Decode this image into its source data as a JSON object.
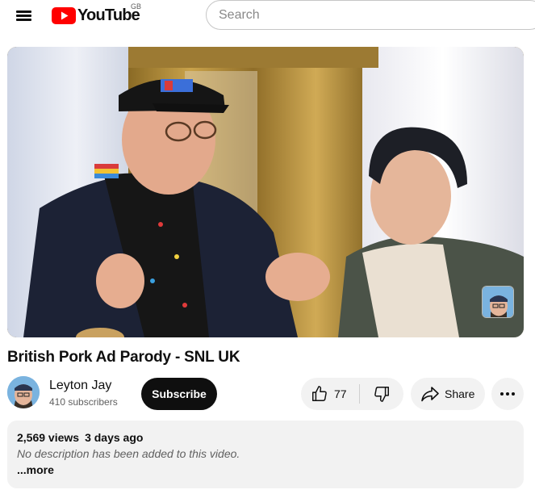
{
  "header": {
    "logo_text": "YouTube",
    "region": "GB",
    "search_placeholder": "Search"
  },
  "video": {
    "title": "British Pork Ad Parody - SNL UK"
  },
  "channel": {
    "name": "Leyton Jay",
    "subscribers": "410 subscribers",
    "subscribe_label": "Subscribe"
  },
  "actions": {
    "like_count": "77",
    "share_label": "Share"
  },
  "description": {
    "views": "2,569 views",
    "date": "3 days ago",
    "text": "No description has been added to this video.",
    "more_label": "...more"
  },
  "colors": {
    "brand_red": "#ff0000",
    "button_bg": "#f2f2f2",
    "subscribe_bg": "#0f0f0f"
  },
  "icons": [
    "menu-icon",
    "youtube-logo-icon",
    "thumbs-up-icon",
    "thumbs-down-icon",
    "share-icon",
    "more-icon"
  ]
}
